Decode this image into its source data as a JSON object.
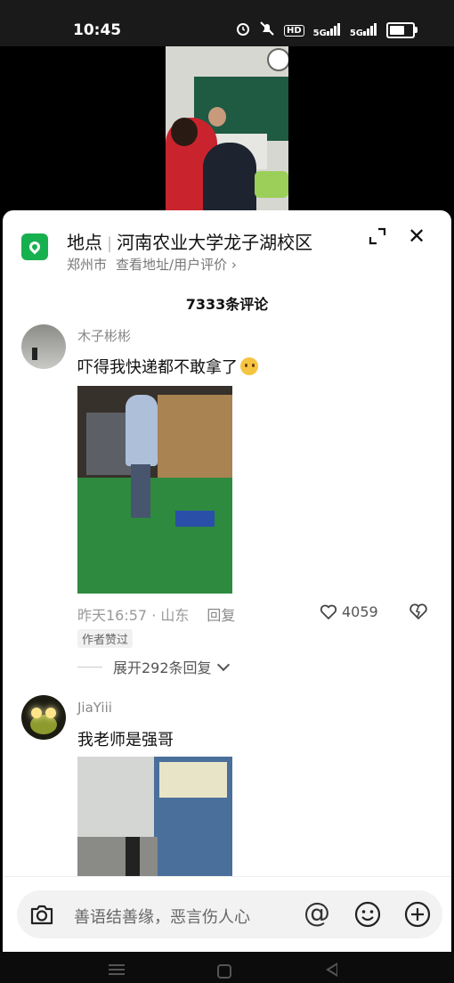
{
  "status_bar": {
    "time": "10:45",
    "icons": [
      "alarm-icon",
      "mute-icon",
      "hd-icon",
      "5g-signal-icon",
      "5g-signal-icon",
      "battery-icon"
    ],
    "hd_label": "HD",
    "net1": "5G",
    "net2": "5G"
  },
  "location": {
    "label": "地点",
    "name": "河南农业大学龙子湖校区",
    "city": "郑州市",
    "link": "查看地址/用户评价 ›",
    "accent": "#17b04f"
  },
  "comments_count": "7333条评论",
  "comments": [
    {
      "user": "木子彬彬",
      "text": "吓得我快递都不敢拿了",
      "time_place": "昨天16:57 · 山东",
      "reply_label": "回复",
      "likes": "4059",
      "author_badge": "作者赞过",
      "expand_label": "展开292条回复"
    },
    {
      "user": "JiaYiii",
      "text": "我老师是强哥"
    }
  ],
  "input": {
    "placeholder": "善语结善缘，恶言伤人心",
    "at": "@"
  }
}
